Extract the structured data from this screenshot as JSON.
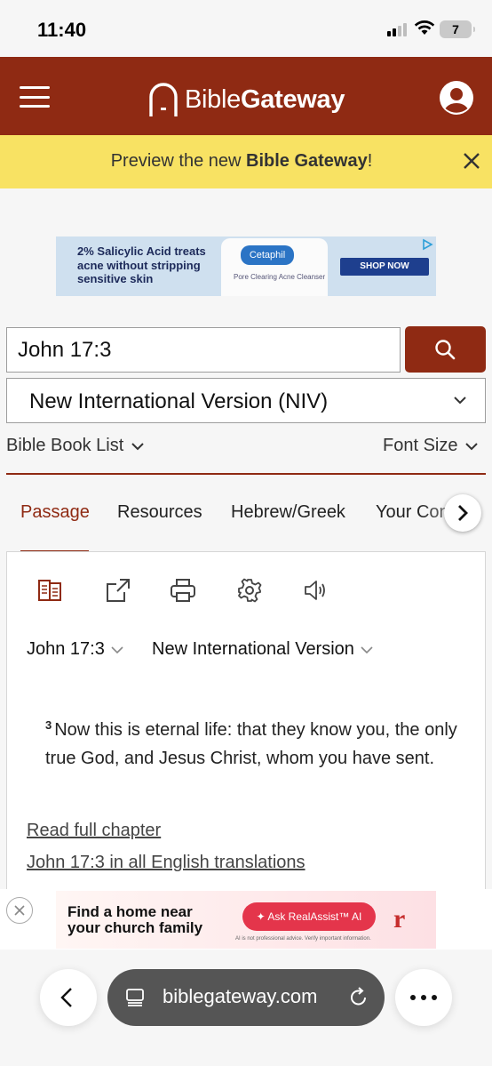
{
  "status_bar": {
    "time": "11:40",
    "battery": "7"
  },
  "header": {
    "logo_light": "Bible",
    "logo_bold": "Gateway"
  },
  "preview_banner": {
    "prefix": "Preview the new ",
    "bold": "Bible Gateway",
    "suffix": "!"
  },
  "ad_top": {
    "text": "2% Salicylic Acid treats acne without stripping sensitive skin",
    "brand": "Cetaphil",
    "product": "Pore Clearing Acne Cleanser",
    "cta": "SHOP NOW"
  },
  "search": {
    "value": "John 17:3"
  },
  "version_select": {
    "selected": "New International Version (NIV)"
  },
  "controls": {
    "book_list": "Bible Book List",
    "font_size": "Font Size"
  },
  "tabs": [
    {
      "label": "Passage",
      "active": true
    },
    {
      "label": "Resources"
    },
    {
      "label": "Hebrew/Greek"
    },
    {
      "label": "Your Content"
    }
  ],
  "passage": {
    "reference": "John 17:3",
    "version": "New International Version",
    "verse_number": "3",
    "verse_text": "Now this is eternal life: that they know you, the only true God, and Jesus Christ, whom you have sent.",
    "links": [
      "Read full chapter",
      "John 17:3 in all English translations"
    ]
  },
  "ad_bottom": {
    "headline": "Find a home near your church family",
    "cta": "Ask RealAssist™ AI",
    "disclaimer": "AI is not professional advice. Verify important information.",
    "logo": "r"
  },
  "browser": {
    "url": "biblegateway.com"
  },
  "colors": {
    "brand": "#8f2a13",
    "banner": "#f8e263",
    "url_bar": "#555555"
  }
}
